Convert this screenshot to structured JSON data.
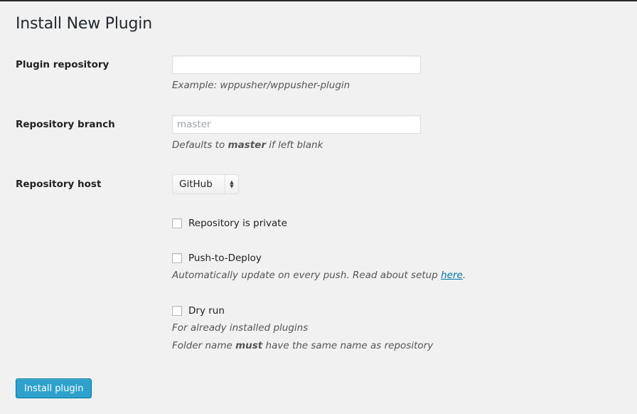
{
  "page": {
    "title": "Install New Plugin"
  },
  "fields": {
    "repository": {
      "label": "Plugin repository",
      "value": "",
      "placeholder": "",
      "description": "Example: wppusher/wppusher-plugin"
    },
    "branch": {
      "label": "Repository branch",
      "value": "",
      "placeholder": "master",
      "description_prefix": "Defaults to ",
      "description_bold": "master",
      "description_suffix": " if left blank"
    },
    "host": {
      "label": "Repository host",
      "selected": "GitHub",
      "arrows_icon": "up-down-arrows-icon"
    }
  },
  "options": {
    "private": {
      "label": "Repository is private",
      "checked": false
    },
    "push_to_deploy": {
      "label": "Push-to-Deploy",
      "checked": false,
      "description_prefix": "Automatically update on every push. Read about setup ",
      "link_text": "here",
      "description_suffix": "."
    },
    "dry_run": {
      "label": "Dry run",
      "checked": false,
      "description_1": "For already installed plugins",
      "description_2_prefix": "Folder name ",
      "description_2_bold": "must",
      "description_2_suffix": " have the same name as repository"
    }
  },
  "actions": {
    "install_label": "Install plugin"
  },
  "colors": {
    "primary_button": "#2ea2cc",
    "link": "#0073aa",
    "background": "#f1f1f1"
  }
}
